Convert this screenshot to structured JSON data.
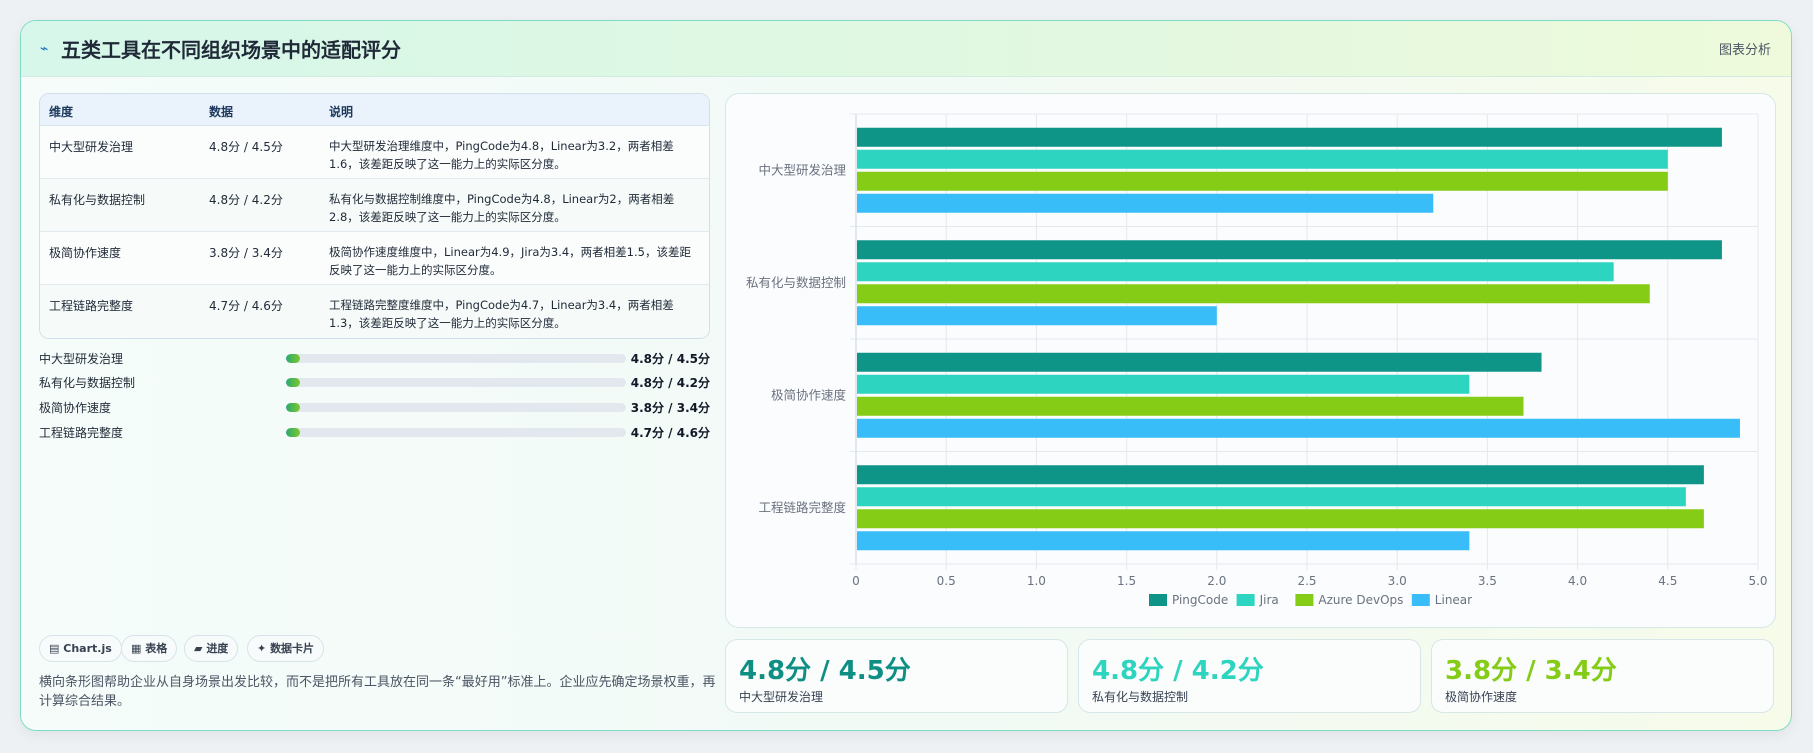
{
  "header": {
    "icon": "chart-line-icon",
    "title": "五类工具在不同组织场景中的适配评分",
    "right_label": "图表分析"
  },
  "table": {
    "headers": [
      "维度",
      "数据",
      "说明"
    ],
    "rows": [
      {
        "dim": "中大型研发治理",
        "data": "4.8分 / 4.5分",
        "desc": "中大型研发治理维度中，PingCode为4.8，Linear为3.2，两者相差1.6，该差距反映了这一能力上的实际区分度。"
      },
      {
        "dim": "私有化与数据控制",
        "data": "4.8分 / 4.2分",
        "desc": "私有化与数据控制维度中，PingCode为4.8，Linear为2，两者相差2.8，该差距反映了这一能力上的实际区分度。"
      },
      {
        "dim": "极简协作速度",
        "data": "3.8分 / 3.4分",
        "desc": "极简协作速度维度中，Linear为4.9，Jira为3.4，两者相差1.5，该差距反映了这一能力上的实际区分度。"
      },
      {
        "dim": "工程链路完整度",
        "data": "4.7分 / 4.6分",
        "desc": "工程链路完整度维度中，PingCode为4.7，Linear为3.4，两者相差1.3，该差距反映了这一能力上的实际区分度。"
      }
    ]
  },
  "progress": [
    {
      "label": "中大型研发治理",
      "value": "4.8分 / 4.5分",
      "fraction": 0.04
    },
    {
      "label": "私有化与数据控制",
      "value": "4.8分 / 4.2分",
      "fraction": 0.04
    },
    {
      "label": "极简协作速度",
      "value": "3.8分 / 3.4分",
      "fraction": 0.04
    },
    {
      "label": "工程链路完整度",
      "value": "4.7分 / 4.6分",
      "fraction": 0.04
    }
  ],
  "tags": [
    {
      "icon": "chart-icon",
      "glyph": "▤",
      "label": "Chart.js"
    },
    {
      "icon": "table-icon",
      "glyph": "▦",
      "label": "表格"
    },
    {
      "icon": "progress-icon",
      "glyph": "▰",
      "label": "进度"
    },
    {
      "icon": "sparkle-icon",
      "glyph": "✦",
      "label": "数据卡片"
    }
  ],
  "note": "横向条形图帮助企业从自身场景出发比较，而不是把所有工具放在同一条“最好用”标准上。企业应先确定场景权重，再计算综合结果。",
  "stats": [
    {
      "value": "4.8分 / 4.5分",
      "label": "中大型研发治理",
      "color": "#0f8f83"
    },
    {
      "value": "4.8分 / 4.2分",
      "label": "私有化与数据控制",
      "color": "#2dd4bf"
    },
    {
      "value": "3.8分 / 3.4分",
      "label": "极简协作速度",
      "color": "#84cc16"
    }
  ],
  "chart_data": {
    "type": "bar",
    "orientation": "horizontal",
    "categories": [
      "中大型研发治理",
      "私有化与数据控制",
      "极简协作速度",
      "工程链路完整度"
    ],
    "series": [
      {
        "name": "PingCode",
        "color": "#0f9488",
        "values": [
          4.8,
          4.8,
          3.8,
          4.7
        ]
      },
      {
        "name": "Jira",
        "color": "#2dd4bf",
        "values": [
          4.5,
          4.2,
          3.4,
          4.6
        ]
      },
      {
        "name": "Azure DevOps",
        "color": "#84cc16",
        "values": [
          4.5,
          4.4,
          3.7,
          4.7
        ]
      },
      {
        "name": "Linear",
        "color": "#38bdf8",
        "values": [
          3.2,
          2.0,
          4.9,
          3.4
        ]
      }
    ],
    "xlim": [
      0,
      5
    ],
    "xticks": [
      "0",
      "0.5",
      "1.0",
      "1.5",
      "2.0",
      "2.5",
      "3.0",
      "3.5",
      "4.0",
      "4.5",
      "5.0"
    ],
    "grid": true,
    "legend": "bottom"
  }
}
